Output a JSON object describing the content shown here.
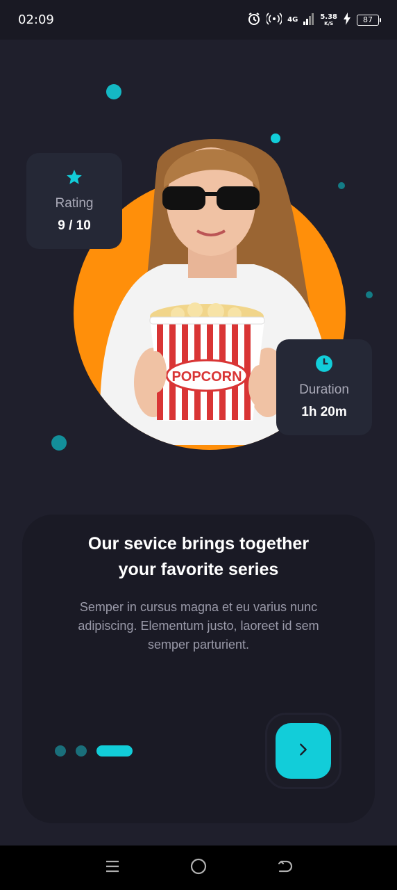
{
  "status_bar": {
    "time": "02:09",
    "network": "4G",
    "speed_value": "5.38",
    "speed_unit": "K/S",
    "battery": "87",
    "icons": [
      "alarm-icon",
      "hotspot-icon",
      "signal-icon",
      "charging-icon",
      "battery-icon"
    ]
  },
  "hero": {
    "rating_card": {
      "icon": "star-icon",
      "label": "Rating",
      "value": "9 / 10"
    },
    "duration_card": {
      "icon": "clock-icon",
      "label": "Duration",
      "value": "1h 20m"
    },
    "popcorn_text": "POPCORN"
  },
  "onboarding": {
    "title_line1": "Our sevice brings together",
    "title_line2": "your favorite series",
    "body": "Semper in cursus magna et eu varius nunc adipiscing. Elementum justo, laoreet id sem semper parturient.",
    "page_count": 3,
    "active_page": 3,
    "next_icon": "chevron-right-icon"
  },
  "nav_bar": {
    "items": [
      "menu-icon",
      "home-icon",
      "back-icon"
    ]
  },
  "colors": {
    "background": "#1f1f2c",
    "accent": "#12cdd9",
    "orange": "#ff8f0a",
    "card": "#252836"
  }
}
